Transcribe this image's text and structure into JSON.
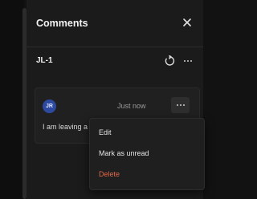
{
  "panel": {
    "title": "Comments",
    "issue_id": "JL-1"
  },
  "comment": {
    "author_initials": "JR",
    "time": "Just now",
    "text": "I am leaving a"
  },
  "menu": {
    "items": [
      {
        "label": "Edit"
      },
      {
        "label": "Mark as unread"
      },
      {
        "label": "Delete"
      }
    ]
  },
  "icons": {
    "close": "close-icon",
    "refresh": "refresh-icon",
    "more": "more-horizontal-icon"
  },
  "colors": {
    "background": "#121212",
    "panel": "#1b1b1b",
    "avatar": "#2e4aa0",
    "delete": "#e2694b"
  }
}
